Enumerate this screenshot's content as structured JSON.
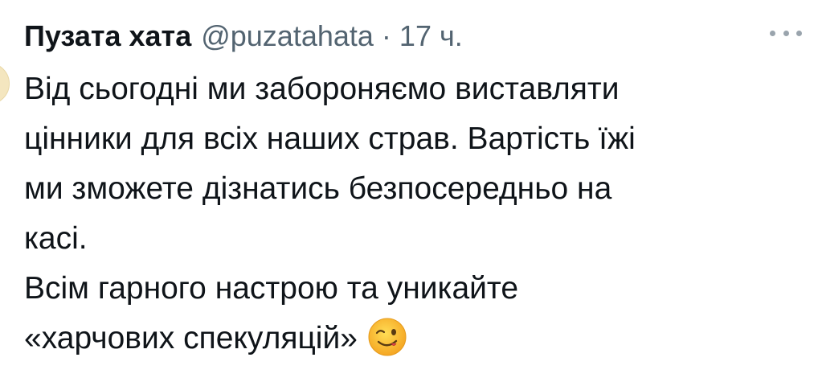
{
  "tweet": {
    "author": {
      "display_name": "Пузата хата",
      "handle": "@puzatahata"
    },
    "separator": "·",
    "timestamp": "17 ч.",
    "more_icon": "more-horizontal-icon",
    "lines": [
      "Від сьогодні ми забороняємо виставляти",
      "цінники для всіх наших страв. Вартість їжі",
      "ми зможете дізнатись безпосередньо на",
      "касі.",
      "Всім гарного настрою та уникайте",
      "«харчових спекуляцій»"
    ],
    "emoji": "winking-face-emoji"
  },
  "colors": {
    "text_primary": "#0f1419",
    "text_secondary": "#536471",
    "background": "#ffffff",
    "emoji_face": "#f7b82e"
  }
}
